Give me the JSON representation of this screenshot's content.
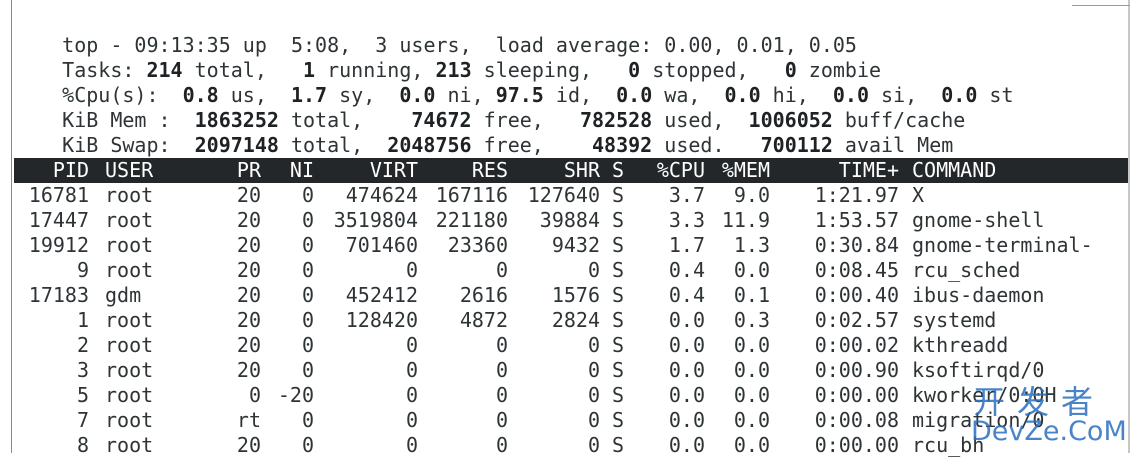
{
  "summary": {
    "uptime_line": [
      "top - ",
      "09:13:35",
      " up  ",
      "5:08,",
      "  ",
      "3",
      " users,  load average: ",
      "0.00, 0.01, 0.05"
    ],
    "tasks_line": [
      "Tasks: ",
      "214",
      " total,   ",
      "1",
      " running, ",
      "213",
      " sleeping,   ",
      "0",
      " stopped,   ",
      "0",
      " zombie"
    ],
    "cpu_line": [
      "%Cpu(s):  ",
      "0.8",
      " us,  ",
      "1.7",
      " sy,  ",
      "0.0",
      " ni, ",
      "97.5",
      " id,  ",
      "0.0",
      " wa,  ",
      "0.0",
      " hi,  ",
      "0.0",
      " si,  ",
      "0.0",
      " st"
    ],
    "mem_line": [
      "KiB Mem :  ",
      "1863252",
      " total,    ",
      "74672",
      " free,   ",
      "782528",
      " used,  ",
      "1006052",
      " buff/cache"
    ],
    "swap_line": [
      "KiB Swap:  ",
      "2097148",
      " total,  ",
      "2048756",
      " free,    ",
      "48392",
      " used.   ",
      "700112",
      " avail Mem"
    ]
  },
  "columns": [
    "PID",
    "USER",
    "PR",
    "NI",
    "VIRT",
    "RES",
    "SHR",
    "S",
    "%CPU",
    "%MEM",
    "TIME+",
    "COMMAND"
  ],
  "processes": [
    [
      "16781",
      "root",
      "20",
      "0",
      "474624",
      "167116",
      "127640",
      "S",
      "3.7",
      "9.0",
      "1:21.97",
      "X"
    ],
    [
      "17447",
      "root",
      "20",
      "0",
      "3519804",
      "221180",
      "39884",
      "S",
      "3.3",
      "11.9",
      "1:53.57",
      "gnome-shell"
    ],
    [
      "19912",
      "root",
      "20",
      "0",
      "701460",
      "23360",
      "9432",
      "S",
      "1.7",
      "1.3",
      "0:30.84",
      "gnome-terminal-"
    ],
    [
      "9",
      "root",
      "20",
      "0",
      "0",
      "0",
      "0",
      "S",
      "0.4",
      "0.0",
      "0:08.45",
      "rcu_sched"
    ],
    [
      "17183",
      "gdm",
      "20",
      "0",
      "452412",
      "2616",
      "1576",
      "S",
      "0.4",
      "0.1",
      "0:00.40",
      "ibus-daemon"
    ],
    [
      "1",
      "root",
      "20",
      "0",
      "128420",
      "4872",
      "2824",
      "S",
      "0.0",
      "0.3",
      "0:02.57",
      "systemd"
    ],
    [
      "2",
      "root",
      "20",
      "0",
      "0",
      "0",
      "0",
      "S",
      "0.0",
      "0.0",
      "0:00.02",
      "kthreadd"
    ],
    [
      "3",
      "root",
      "20",
      "0",
      "0",
      "0",
      "0",
      "S",
      "0.0",
      "0.0",
      "0:00.90",
      "ksoftirqd/0"
    ],
    [
      "5",
      "root",
      "0",
      "-20",
      "0",
      "0",
      "0",
      "S",
      "0.0",
      "0.0",
      "0:00.00",
      "kworker/0:0H"
    ],
    [
      "7",
      "root",
      "rt",
      "0",
      "0",
      "0",
      "0",
      "S",
      "0.0",
      "0.0",
      "0:00.08",
      "migration/0"
    ],
    [
      "8",
      "root",
      "20",
      "0",
      "0",
      "0",
      "0",
      "S",
      "0.0",
      "0.0",
      "0:00.00",
      "rcu_bh"
    ]
  ],
  "watermark": {
    "cn": "开发者",
    "en": "DevZe.CoM",
    "color": "#2a6fc0"
  },
  "colors": {
    "header_bg": "#232729",
    "header_fg": "#ffffff",
    "text": "#2e3436"
  }
}
